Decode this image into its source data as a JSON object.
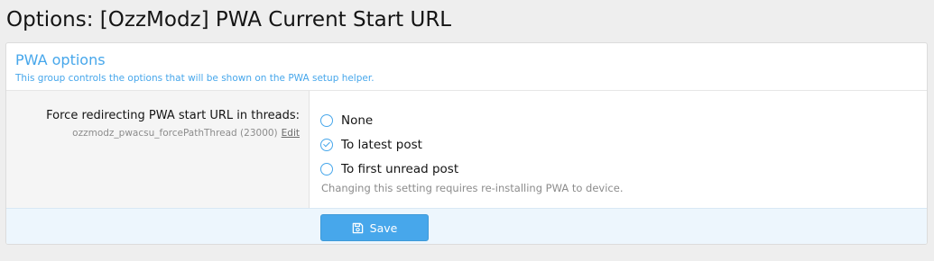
{
  "page": {
    "title": "Options: [OzzModz] PWA Current Start URL"
  },
  "group": {
    "title": "PWA options",
    "description": "This group controls the options that will be shown on the PWA setup helper."
  },
  "option": {
    "label": "Force redirecting PWA start URL in threads:",
    "hint": "ozzmodz_pwacsu_forcePathThread (23000)",
    "edit_label": "Edit",
    "choices": [
      {
        "label": "None",
        "checked": false
      },
      {
        "label": "To latest post",
        "checked": true
      },
      {
        "label": "To first unread post",
        "checked": false
      }
    ],
    "explain": "Changing this setting requires re-installing PWA to device."
  },
  "footer": {
    "save_label": "Save",
    "save_icon": "save-icon"
  },
  "colors": {
    "accent": "#47a7eb",
    "footer_bg": "#edf6fd"
  }
}
